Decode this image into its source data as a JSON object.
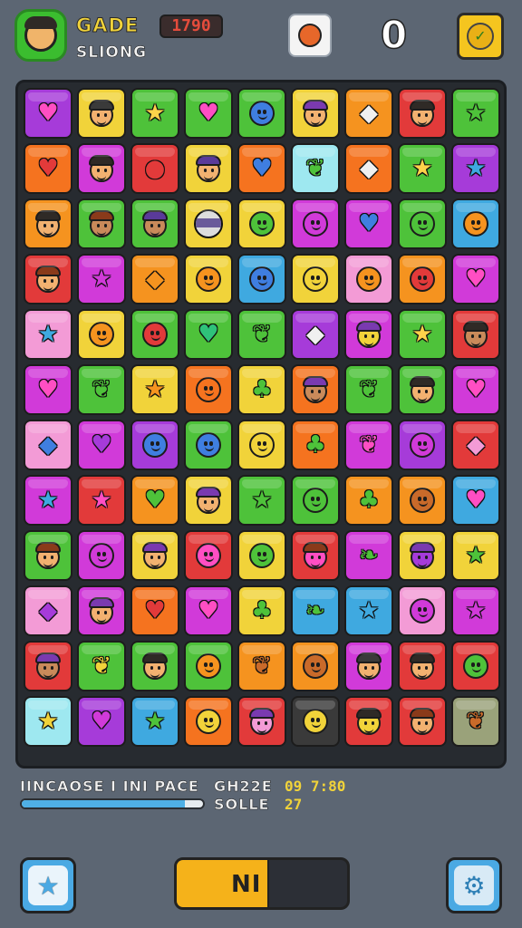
{
  "header": {
    "title": "GADE",
    "score": "1790",
    "subtitle": "SLIONG",
    "counter": "0"
  },
  "footer": {
    "info_label": "IINCAOSE I INI PACE",
    "stat1_label": "GH22E",
    "stat1_value": "09 7:80",
    "stat2_label": "SOLLE",
    "stat2_value": "27",
    "progress": 0.9,
    "action_label": "NI"
  },
  "colors": {
    "background": "#5c6673",
    "board": "#272b30",
    "accent_yellow": "#f5c51f",
    "accent_blue": "#4aa9e3"
  },
  "icons": {
    "avatar": "character-face-icon",
    "ball": "basketball-icon",
    "reward": "leaf-badge-icon",
    "star": "star-icon",
    "gear": "gear-icon"
  },
  "board": [
    [
      [
        "#a63bd9",
        "heart",
        "#ff4ec3"
      ],
      [
        "#f1d33a",
        "face",
        "#f2b170"
      ],
      [
        "#4ec23a",
        "star",
        "#ffd24a"
      ],
      [
        "#4ec23a",
        "heart",
        "#ff4ec3"
      ],
      [
        "#4ec23a",
        "blob",
        "#3f7ee0"
      ],
      [
        "#f1d33a",
        "face",
        "#f2b170"
      ],
      [
        "#f5931f",
        "shard",
        "#f0f0f0"
      ],
      [
        "#e23a3a",
        "face",
        "#f2b170"
      ],
      [
        "#4ec23a",
        "star",
        "#4ec23a"
      ]
    ],
    [
      [
        "#f5731f",
        "heart",
        "#e23a3a"
      ],
      [
        "#d13ad9",
        "face",
        "#f2b170"
      ],
      [
        "#e23a3a",
        "apple",
        "#e23a3a"
      ],
      [
        "#f1d33a",
        "face",
        "#f2b170"
      ],
      [
        "#f5731f",
        "heart",
        "#3f7ee0"
      ],
      [
        "#9ee8f0",
        "leaf",
        "#4ec23a"
      ],
      [
        "#f5731f",
        "shard",
        "#f0f0f0"
      ],
      [
        "#4ec23a",
        "star",
        "#ffd24a"
      ],
      [
        "#a63bd9",
        "star",
        "#3fa9e0"
      ]
    ],
    [
      [
        "#f5931f",
        "face",
        "#f2b170"
      ],
      [
        "#4ec23a",
        "face",
        "#c98a5a"
      ],
      [
        "#4ec23a",
        "face",
        "#c98a5a"
      ],
      [
        "#f1d33a",
        "marble",
        ""
      ],
      [
        "#f1d33a",
        "blob",
        "#4ec23a"
      ],
      [
        "#d13ad9",
        "blob",
        "#d13ad9"
      ],
      [
        "#d13ad9",
        "heart",
        "#3f7ee0"
      ],
      [
        "#4ec23a",
        "blob",
        "#4ec23a"
      ],
      [
        "#3fa9e0",
        "blob",
        "#f5931f"
      ]
    ],
    [
      [
        "#e23a3a",
        "face",
        "#f2b170"
      ],
      [
        "#d13ad9",
        "star",
        "#d13ad9"
      ],
      [
        "#f5931f",
        "shard",
        "#f5931f"
      ],
      [
        "#f1d33a",
        "blob",
        "#f5931f"
      ],
      [
        "#3fa9e0",
        "blob",
        "#3f7ee0"
      ],
      [
        "#f1d33a",
        "blob",
        "#f1d33a"
      ],
      [
        "#f39bd6",
        "blob",
        "#f5931f"
      ],
      [
        "#f5931f",
        "blob",
        "#e23a3a"
      ],
      [
        "#d13ad9",
        "heart",
        "#ff4ec3"
      ]
    ],
    [
      [
        "#f39bd6",
        "star",
        "#3fa9e0"
      ],
      [
        "#f1d33a",
        "blob",
        "#f5931f"
      ],
      [
        "#4ec23a",
        "blob",
        "#e23a3a"
      ],
      [
        "#4ec23a",
        "heart",
        "#2fc27a"
      ],
      [
        "#4ec23a",
        "leaf",
        "#4ec23a"
      ],
      [
        "#a63bd9",
        "shard",
        "#f0f0f0"
      ],
      [
        "#d13ad9",
        "face",
        "#f1d33a"
      ],
      [
        "#4ec23a",
        "star",
        "#ffd24a"
      ],
      [
        "#e23a3a",
        "face",
        "#c98a5a"
      ]
    ],
    [
      [
        "#d13ad9",
        "heart",
        "#ff4ec3"
      ],
      [
        "#4ec23a",
        "leaf",
        "#4ec23a"
      ],
      [
        "#f1d33a",
        "star",
        "#f5931f"
      ],
      [
        "#f5731f",
        "blob",
        "#f5731f"
      ],
      [
        "#f1d33a",
        "clover",
        "#4ec23a"
      ],
      [
        "#f5731f",
        "face",
        "#c98a5a"
      ],
      [
        "#4ec23a",
        "leaf",
        "#4ec23a"
      ],
      [
        "#4ec23a",
        "face",
        "#f2b170"
      ],
      [
        "#d13ad9",
        "heart",
        "#ff4ec3"
      ]
    ],
    [
      [
        "#f39bd6",
        "shard",
        "#3f7ee0"
      ],
      [
        "#d13ad9",
        "heart",
        "#a63bd9"
      ],
      [
        "#a63bd9",
        "blob",
        "#3f7ee0"
      ],
      [
        "#4ec23a",
        "blob",
        "#3f7ee0"
      ],
      [
        "#f1d33a",
        "blob",
        "#f1d33a"
      ],
      [
        "#f5731f",
        "clover",
        "#4ec23a"
      ],
      [
        "#d13ad9",
        "leaf",
        "#ff4ec3"
      ],
      [
        "#a63bd9",
        "blob",
        "#d13ad9"
      ],
      [
        "#e23a3a",
        "shard",
        "#f39bd6"
      ]
    ],
    [
      [
        "#d13ad9",
        "star",
        "#3fa9e0"
      ],
      [
        "#e23a3a",
        "star",
        "#ff4ec3"
      ],
      [
        "#f5931f",
        "heart",
        "#4ec23a"
      ],
      [
        "#f1d33a",
        "face",
        "#f2b170"
      ],
      [
        "#4ec23a",
        "star",
        "#4ec23a"
      ],
      [
        "#4ec23a",
        "blob",
        "#4ec23a"
      ],
      [
        "#f5931f",
        "clover",
        "#4ec23a"
      ],
      [
        "#f5931f",
        "blob",
        "#c96a2a"
      ],
      [
        "#3fa9e0",
        "heart",
        "#ff4ec3"
      ]
    ],
    [
      [
        "#4ec23a",
        "face",
        "#f2b170"
      ],
      [
        "#d13ad9",
        "blob",
        "#d13ad9"
      ],
      [
        "#f1d33a",
        "face",
        "#f2b170"
      ],
      [
        "#e23a3a",
        "blob",
        "#ff4ec3"
      ],
      [
        "#f1d33a",
        "blob",
        "#4ec23a"
      ],
      [
        "#e23a3a",
        "face",
        "#ff4ec3"
      ],
      [
        "#d13ad9",
        "pepper",
        "#4ec23a"
      ],
      [
        "#f1d33a",
        "face",
        "#a63bd9"
      ],
      [
        "#f1d33a",
        "star",
        "#4ec23a"
      ]
    ],
    [
      [
        "#f39bd6",
        "shard",
        "#a63bd9"
      ],
      [
        "#d13ad9",
        "face",
        "#f2b170"
      ],
      [
        "#f5731f",
        "heart",
        "#e23a3a"
      ],
      [
        "#d13ad9",
        "heart",
        "#ff4ec3"
      ],
      [
        "#f1d33a",
        "clover",
        "#4ec23a"
      ],
      [
        "#3fa9e0",
        "pepper",
        "#4ec23a"
      ],
      [
        "#3fa9e0",
        "star",
        "#3fa9e0"
      ],
      [
        "#f39bd6",
        "blob",
        "#d13ad9"
      ],
      [
        "#d13ad9",
        "star",
        "#d13ad9"
      ]
    ],
    [
      [
        "#e23a3a",
        "face",
        "#c98a5a"
      ],
      [
        "#4ec23a",
        "leaf",
        "#f1d33a"
      ],
      [
        "#4ec23a",
        "face",
        "#f2b170"
      ],
      [
        "#4ec23a",
        "blob",
        "#f5931f"
      ],
      [
        "#f5931f",
        "leaf",
        "#c96a2a"
      ],
      [
        "#f5931f",
        "blob",
        "#c96a2a"
      ],
      [
        "#d13ad9",
        "face",
        "#f2b170"
      ],
      [
        "#e23a3a",
        "face",
        "#f2b170"
      ],
      [
        "#e23a3a",
        "blob",
        "#4ec23a"
      ]
    ],
    [
      [
        "#9ee8f0",
        "star",
        "#f1d33a"
      ],
      [
        "#a63bd9",
        "heart",
        "#d13ad9"
      ],
      [
        "#3fa9e0",
        "star",
        "#4ec23a"
      ],
      [
        "#f5731f",
        "blob",
        "#f1d33a"
      ],
      [
        "#e23a3a",
        "face",
        "#f39bd6"
      ],
      [
        "#3a3a3a",
        "blob",
        "#f1d33a"
      ],
      [
        "#e23a3a",
        "face",
        "#f1d33a"
      ],
      [
        "#e23a3a",
        "face",
        "#f2b170"
      ],
      [
        "#9aa27a",
        "leaf",
        "#c96a2a"
      ]
    ]
  ]
}
